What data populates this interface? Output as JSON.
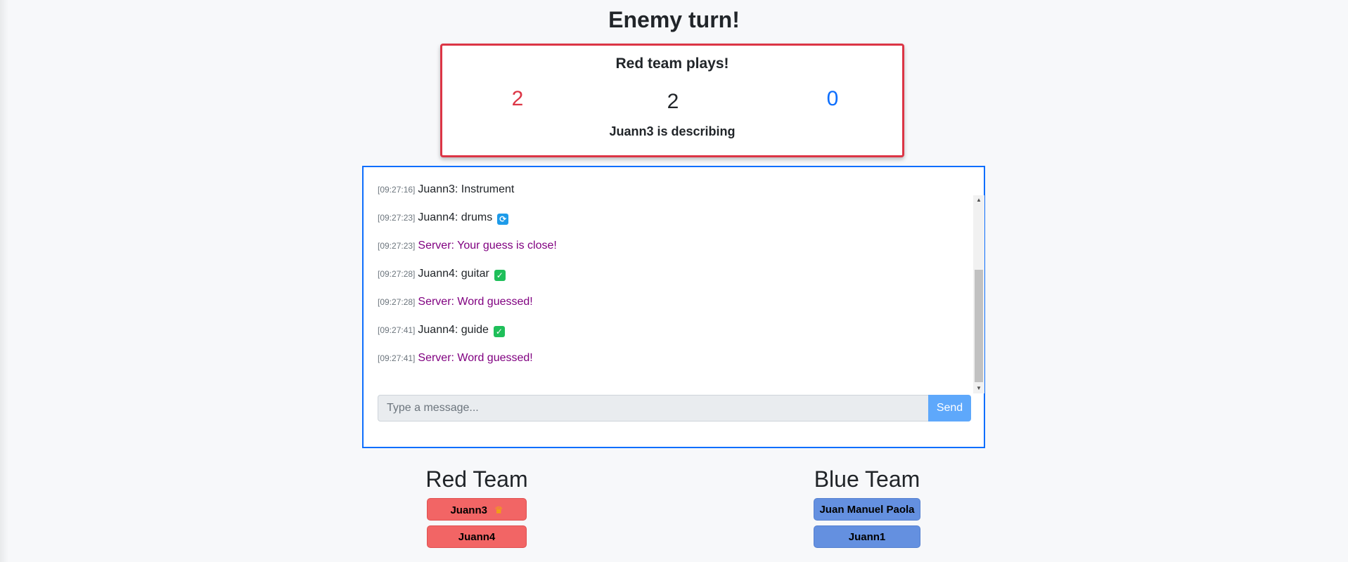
{
  "header": {
    "turn_title": "Enemy turn!"
  },
  "scoreboard": {
    "plays_title": "Red team plays!",
    "red_score": "2",
    "center_value": "2",
    "blue_score": "0",
    "describing_text": "Juann3 is describing",
    "border_color": "#dc3545"
  },
  "chat": {
    "messages": [
      {
        "time": "[09:27:16]",
        "text": "Juann3: Instrument",
        "type": "user",
        "icon": ""
      },
      {
        "time": "[09:27:23]",
        "text": "Juann4: drums",
        "type": "user",
        "icon": "refresh-icon"
      },
      {
        "time": "[09:27:23]",
        "text": "Server: Your guess is close!",
        "type": "server",
        "icon": ""
      },
      {
        "time": "[09:27:28]",
        "text": "Juann4: guitar",
        "type": "user",
        "icon": "check-icon"
      },
      {
        "time": "[09:27:28]",
        "text": "Server: Word guessed!",
        "type": "server",
        "icon": ""
      },
      {
        "time": "[09:27:41]",
        "text": "Juann4: guide",
        "type": "user",
        "icon": "check-icon"
      },
      {
        "time": "[09:27:41]",
        "text": "Server: Word guessed!",
        "type": "server",
        "icon": ""
      }
    ],
    "input_placeholder": "Type a message...",
    "input_value": "",
    "send_label": "Send",
    "server_color": "#800080"
  },
  "teams": {
    "red": {
      "title": "Red Team",
      "players": [
        {
          "name": "Juann3",
          "icon": "crown-icon"
        },
        {
          "name": "Juann4",
          "icon": ""
        }
      ],
      "color": "#f26565"
    },
    "blue": {
      "title": "Blue Team",
      "players": [
        {
          "name": "Juan Manuel Paola",
          "icon": ""
        },
        {
          "name": "Juann1",
          "icon": ""
        }
      ],
      "color": "#6490e0"
    }
  }
}
